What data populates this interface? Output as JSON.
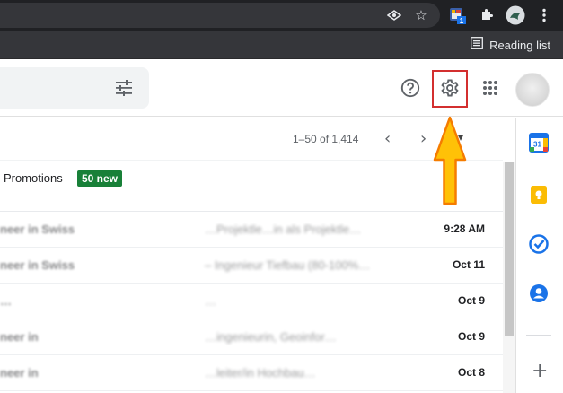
{
  "browser": {
    "bookmarks_bar": {
      "reading_list_label": "Reading list"
    },
    "extension_badge": "1"
  },
  "header": {
    "icons": [
      "help-icon",
      "settings-icon",
      "apps-grid-icon"
    ]
  },
  "toolbar": {
    "pagination": "1–50 of 1,414"
  },
  "promotions": {
    "label": "Promotions",
    "badge": "50 new"
  },
  "emails": [
    {
      "sender": "neer in Swiss",
      "subject": "…Projektle…in als Projektle…",
      "date": "9:28 AM"
    },
    {
      "sender": "neer in Swiss",
      "subject": "– Ingenieur Tiefbau (80-100%…",
      "date": "Oct 11"
    },
    {
      "sender": "…",
      "subject": "…",
      "date": "Oct 9"
    },
    {
      "sender": "neer in",
      "subject": "…ingenieurin, Geoinfor…",
      "date": "Oct 9"
    },
    {
      "sender": "neer in",
      "subject": "…leiter/in Hochbau…",
      "date": "Oct 8"
    }
  ],
  "colors": {
    "highlight_box": "#d32f2f",
    "arrow_fill": "#ffc107",
    "arrow_stroke": "#f57c00",
    "badge_bg": "#188038"
  }
}
